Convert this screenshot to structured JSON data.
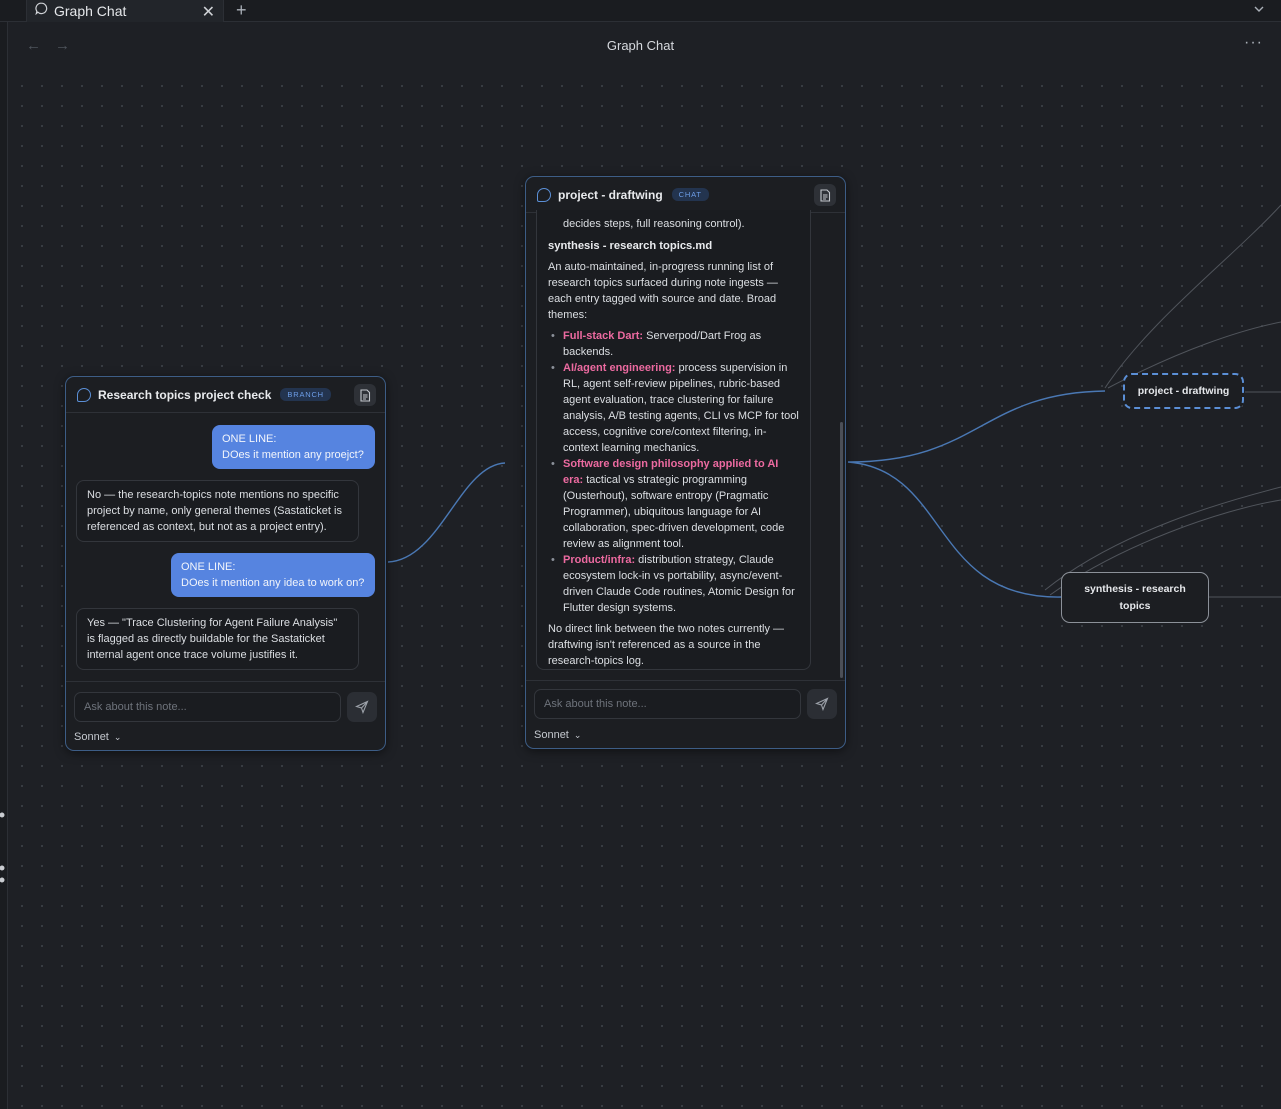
{
  "tab": {
    "title": "Graph Chat",
    "close": "✕",
    "add": "+",
    "menu": "⌄"
  },
  "header": {
    "title": "Graph Chat",
    "back": "←",
    "forward": "→",
    "more": "···"
  },
  "left_panel": {
    "title": "Research topics project check",
    "badge": "BRANCH",
    "messages": [
      {
        "role": "user",
        "lines": [
          "ONE LINE:",
          "DOes it mention any proejct?"
        ]
      },
      {
        "role": "assistant",
        "lines": [
          "No — the research-topics note mentions no specific",
          "project by name, only general themes (Sastaticket is",
          "referenced as context, but not as a project entry)."
        ]
      },
      {
        "role": "user",
        "lines": [
          "ONE LINE:",
          "DOes it mention any idea to work on?"
        ]
      },
      {
        "role": "assistant",
        "lines": [
          "Yes — \"Trace Clustering for Agent Failure Analysis\"",
          "is flagged as directly buildable for the Sastaticket",
          "internal agent once trace volume justifies it."
        ]
      }
    ],
    "input_placeholder": "Ask about this note...",
    "model": "Sonnet"
  },
  "center_panel": {
    "title": "project - draftwing",
    "badge": "CHAT",
    "response": {
      "top_fragment": "decides steps, full reasoning control).",
      "heading": "synthesis - research topics.md",
      "intro": "An auto-maintained, in-progress running list of research topics surfaced during note ingests — each entry tagged with source and date. Broad themes:",
      "bullets": [
        {
          "label": "Full-stack Dart:",
          "text": " Serverpod/Dart Frog as backends."
        },
        {
          "label": "AI/agent engineering:",
          "text": " process supervision in RL, agent self-review pipelines, rubric-based agent evaluation, trace clustering for failure analysis, A/B testing agents, CLI vs MCP for tool access, cognitive core/context filtering, in-context learning mechanics."
        },
        {
          "label": "Software design philosophy applied to AI era:",
          "text": " tactical vs strategic programming (Ousterhout), software entropy (Pragmatic Programmer), ubiquitous language for AI collaboration, spec-driven development, code review as alignment tool."
        },
        {
          "label": "Product/infra:",
          "text": " distribution strategy, Claude ecosystem lock-in vs portability, async/event-driven Claude Code routines, Atomic Design for Flutter design systems."
        }
      ],
      "closing": "No direct link between the two notes currently — draftwing isn't referenced as a source in the research-topics log."
    },
    "input_placeholder": "Ask about this note...",
    "model": "Sonnet"
  },
  "graph_nodes": {
    "draftwing": "project - draftwing",
    "synthesis_line1": "synthesis - research",
    "synthesis_line2": "topics"
  }
}
